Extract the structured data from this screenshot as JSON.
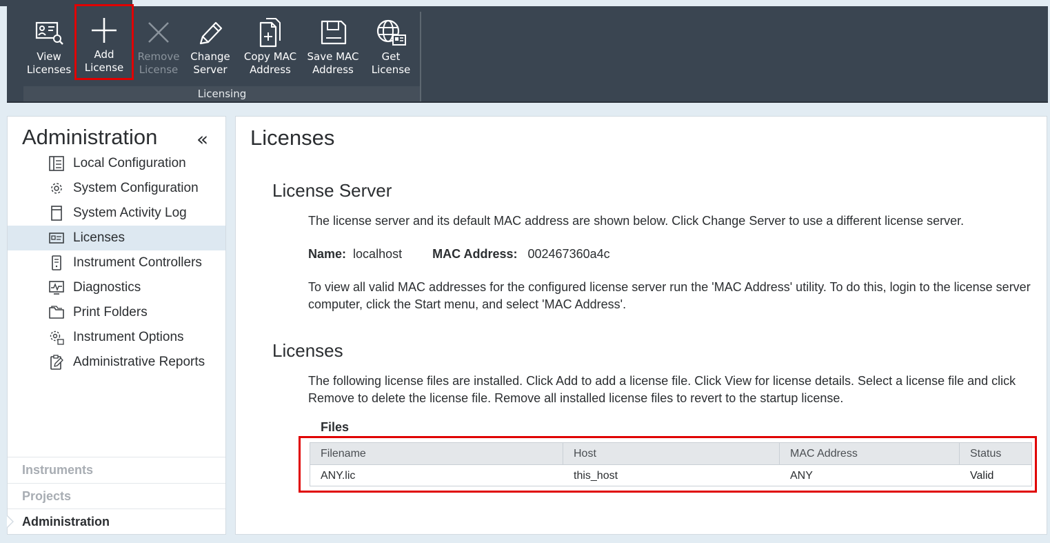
{
  "ribbon": {
    "buttons": [
      {
        "label": "View\nLicenses",
        "icon": "view-licenses-icon",
        "enabled": true
      },
      {
        "label": "Add\nLicense",
        "icon": "plus-icon",
        "enabled": true,
        "highlighted": true
      },
      {
        "label": "Remove\nLicense",
        "icon": "x-icon",
        "enabled": false
      },
      {
        "label": "Change\nServer",
        "icon": "pencil-icon",
        "enabled": true
      },
      {
        "label": "Copy MAC\nAddress",
        "icon": "copy-document-icon",
        "enabled": true
      },
      {
        "label": "Save MAC\nAddress",
        "icon": "floppy-disk-icon",
        "enabled": true
      },
      {
        "label": "Get\nLicense",
        "icon": "globe-license-icon",
        "enabled": true
      }
    ],
    "group_label": "Licensing"
  },
  "sidebar": {
    "title": "Administration",
    "collapse_glyph": "«",
    "items": [
      {
        "label": "Local Configuration",
        "icon": "local-configuration-icon"
      },
      {
        "label": "System Configuration",
        "icon": "gear-icon"
      },
      {
        "label": "System Activity Log",
        "icon": "log-icon"
      },
      {
        "label": "Licenses",
        "icon": "license-card-icon",
        "active": true
      },
      {
        "label": "Instrument Controllers",
        "icon": "instrument-controller-icon"
      },
      {
        "label": "Diagnostics",
        "icon": "diagnostics-icon"
      },
      {
        "label": "Print Folders",
        "icon": "folder-icon"
      },
      {
        "label": "Instrument Options",
        "icon": "instrument-options-icon"
      },
      {
        "label": "Administrative Reports",
        "icon": "reports-icon"
      }
    ],
    "bottom": [
      {
        "label": "Instruments"
      },
      {
        "label": "Projects"
      },
      {
        "label": "Administration",
        "active": true
      }
    ]
  },
  "main": {
    "title": "Licenses",
    "server_section": {
      "title": "License Server",
      "intro": "The license server and its default MAC address are shown below. Click Change Server to use a different license server.",
      "name_label": "Name:",
      "name_value": "localhost",
      "mac_label": "MAC Address:",
      "mac_value": "002467360a4c",
      "note": "To view all valid MAC addresses for the configured license server run the 'MAC Address' utility.  To do this, login to the license server computer, click the Start menu, and select 'MAC Address'."
    },
    "licenses_section": {
      "title": "Licenses",
      "intro": "The following license files are installed. Click Add to add a license file. Click View for license details. Select a license file and click Remove to delete the license file. Remove all installed license files to revert to the startup license.",
      "files_label": "Files",
      "columns": [
        "Filename",
        "Host",
        "MAC Address",
        "Status"
      ],
      "rows": [
        [
          "ANY.lic",
          "this_host",
          "ANY",
          "Valid"
        ]
      ]
    }
  },
  "colors": {
    "ribbon_bg": "#3a4551",
    "highlight_red": "#e00000",
    "active_nav_bg": "#dde8f1",
    "page_bg": "#e2ecf3"
  }
}
